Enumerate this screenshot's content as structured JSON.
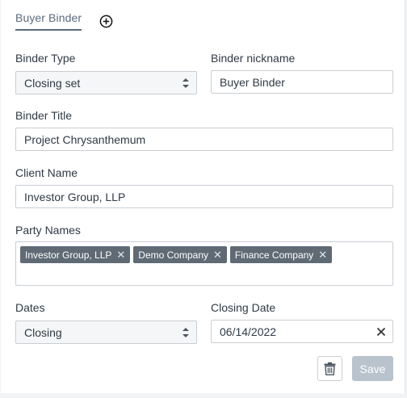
{
  "tabs": [
    {
      "label": "Buyer Binder"
    }
  ],
  "form": {
    "binder_type": {
      "label": "Binder Type",
      "value": "Closing set"
    },
    "binder_nickname": {
      "label": "Binder nickname",
      "value": "Buyer Binder"
    },
    "binder_title": {
      "label": "Binder Title",
      "value": "Project Chrysanthemum"
    },
    "client_name": {
      "label": "Client Name",
      "value": "Investor Group, LLP"
    },
    "party_names": {
      "label": "Party Names",
      "chips": [
        "Investor Group, LLP",
        "Demo Company",
        "Finance Company"
      ]
    },
    "dates": {
      "label": "Dates",
      "value": "Closing"
    },
    "closing_date": {
      "label": "Closing Date",
      "value": "06/14/2022"
    }
  },
  "actions": {
    "save_label": "Save"
  },
  "icons": {
    "add": "plus-circle-icon",
    "trash": "trash-icon",
    "clear": "close-icon",
    "caret": "select-caret-icon",
    "chip_remove": "close-icon"
  },
  "colors": {
    "chip_bg": "#5f6a75",
    "save_disabled": "#b9c3cd",
    "tab_underline": "#5b6b7c"
  }
}
